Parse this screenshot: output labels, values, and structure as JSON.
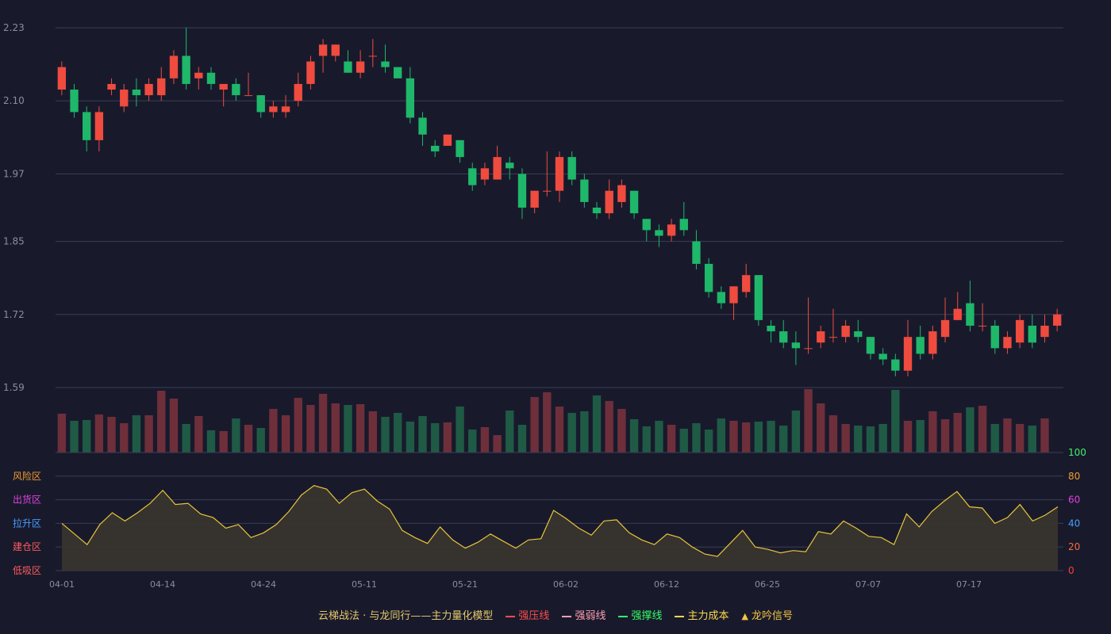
{
  "chart_data": {
    "type": "candlestick",
    "price_axis": {
      "ticks": [
        "2.23",
        "2.10",
        "1.97",
        "1.85",
        "1.72",
        "1.59"
      ],
      "ylim": [
        1.59,
        2.23
      ]
    },
    "x_ticks": [
      "04-01",
      "04-14",
      "04-24",
      "05-11",
      "05-21",
      "06-02",
      "06-12",
      "06-25",
      "07-07",
      "07-17"
    ],
    "candles": [
      [
        2.12,
        2.16,
        2.17,
        2.11
      ],
      [
        2.12,
        2.08,
        2.13,
        2.07
      ],
      [
        2.08,
        2.03,
        2.09,
        2.01
      ],
      [
        2.03,
        2.08,
        2.09,
        2.01
      ],
      [
        2.12,
        2.13,
        2.14,
        2.11
      ],
      [
        2.09,
        2.12,
        2.13,
        2.08
      ],
      [
        2.12,
        2.11,
        2.14,
        2.09
      ],
      [
        2.11,
        2.13,
        2.14,
        2.1
      ],
      [
        2.11,
        2.14,
        2.16,
        2.1
      ],
      [
        2.14,
        2.18,
        2.19,
        2.13
      ],
      [
        2.18,
        2.13,
        2.23,
        2.12
      ],
      [
        2.14,
        2.15,
        2.16,
        2.12
      ],
      [
        2.15,
        2.13,
        2.16,
        2.12
      ],
      [
        2.12,
        2.13,
        2.13,
        2.09
      ],
      [
        2.13,
        2.11,
        2.14,
        2.1
      ],
      [
        2.11,
        2.11,
        2.15,
        2.11
      ],
      [
        2.11,
        2.08,
        2.11,
        2.07
      ],
      [
        2.08,
        2.09,
        2.1,
        2.07
      ],
      [
        2.08,
        2.09,
        2.11,
        2.07
      ],
      [
        2.1,
        2.13,
        2.15,
        2.09
      ],
      [
        2.13,
        2.17,
        2.18,
        2.12
      ],
      [
        2.18,
        2.2,
        2.21,
        2.15
      ],
      [
        2.18,
        2.2,
        2.2,
        2.17
      ],
      [
        2.17,
        2.15,
        2.19,
        2.15
      ],
      [
        2.15,
        2.17,
        2.19,
        2.14
      ],
      [
        2.18,
        2.18,
        2.21,
        2.16
      ],
      [
        2.17,
        2.16,
        2.2,
        2.15
      ],
      [
        2.16,
        2.14,
        2.16,
        2.14
      ],
      [
        2.14,
        2.07,
        2.16,
        2.06
      ],
      [
        2.07,
        2.04,
        2.08,
        2.02
      ],
      [
        2.02,
        2.01,
        2.03,
        2.0
      ],
      [
        2.02,
        2.04,
        2.04,
        2.02
      ],
      [
        2.03,
        2.0,
        2.03,
        1.99
      ],
      [
        1.98,
        1.95,
        1.99,
        1.94
      ],
      [
        1.96,
        1.98,
        1.99,
        1.95
      ],
      [
        1.96,
        2.0,
        2.02,
        1.96
      ],
      [
        1.99,
        1.98,
        2.0,
        1.96
      ],
      [
        1.97,
        1.91,
        1.98,
        1.89
      ],
      [
        1.91,
        1.94,
        1.94,
        1.9
      ],
      [
        1.94,
        1.94,
        2.01,
        1.93
      ],
      [
        1.94,
        2.0,
        2.01,
        1.92
      ],
      [
        2.0,
        1.96,
        2.01,
        1.95
      ],
      [
        1.96,
        1.92,
        1.97,
        1.91
      ],
      [
        1.91,
        1.9,
        1.92,
        1.89
      ],
      [
        1.9,
        1.94,
        1.96,
        1.89
      ],
      [
        1.92,
        1.95,
        1.96,
        1.91
      ],
      [
        1.94,
        1.9,
        1.94,
        1.89
      ],
      [
        1.89,
        1.87,
        1.89,
        1.85
      ],
      [
        1.87,
        1.86,
        1.88,
        1.84
      ],
      [
        1.86,
        1.88,
        1.89,
        1.85
      ],
      [
        1.89,
        1.87,
        1.92,
        1.86
      ],
      [
        1.85,
        1.81,
        1.87,
        1.8
      ],
      [
        1.81,
        1.76,
        1.82,
        1.75
      ],
      [
        1.76,
        1.74,
        1.77,
        1.73
      ],
      [
        1.74,
        1.77,
        1.77,
        1.71
      ],
      [
        1.76,
        1.79,
        1.81,
        1.75
      ],
      [
        1.79,
        1.71,
        1.79,
        1.7
      ],
      [
        1.7,
        1.69,
        1.71,
        1.67
      ],
      [
        1.69,
        1.67,
        1.71,
        1.66
      ],
      [
        1.67,
        1.66,
        1.69,
        1.63
      ],
      [
        1.66,
        1.66,
        1.75,
        1.65
      ],
      [
        1.67,
        1.69,
        1.7,
        1.66
      ],
      [
        1.68,
        1.68,
        1.73,
        1.67
      ],
      [
        1.68,
        1.7,
        1.71,
        1.67
      ],
      [
        1.69,
        1.68,
        1.71,
        1.67
      ],
      [
        1.68,
        1.65,
        1.68,
        1.64
      ],
      [
        1.65,
        1.64,
        1.66,
        1.63
      ],
      [
        1.64,
        1.62,
        1.65,
        1.61
      ],
      [
        1.62,
        1.68,
        1.71,
        1.61
      ],
      [
        1.68,
        1.65,
        1.7,
        1.64
      ],
      [
        1.65,
        1.69,
        1.7,
        1.64
      ],
      [
        1.68,
        1.71,
        1.75,
        1.67
      ],
      [
        1.71,
        1.73,
        1.76,
        1.71
      ],
      [
        1.74,
        1.7,
        1.78,
        1.69
      ],
      [
        1.7,
        1.7,
        1.74,
        1.69
      ],
      [
        1.7,
        1.66,
        1.71,
        1.65
      ],
      [
        1.66,
        1.68,
        1.69,
        1.65
      ],
      [
        1.67,
        1.71,
        1.72,
        1.66
      ],
      [
        1.7,
        1.67,
        1.72,
        1.66
      ],
      [
        1.68,
        1.7,
        1.72,
        1.67
      ],
      [
        1.7,
        1.72,
        1.73,
        1.69
      ]
    ],
    "volume": [
      49,
      40,
      41,
      48,
      45,
      37,
      47,
      47,
      78,
      68,
      36,
      46,
      28,
      27,
      43,
      35,
      31,
      55,
      47,
      69,
      60,
      74,
      62,
      60,
      61,
      52,
      45,
      50,
      39,
      46,
      37,
      38,
      58,
      29,
      32,
      22,
      53,
      35,
      70,
      76,
      58,
      50,
      52,
      72,
      65,
      55,
      42,
      33,
      40,
      35,
      30,
      37,
      29,
      43,
      40,
      38,
      39,
      40,
      34,
      53,
      80,
      62,
      47,
      36,
      34,
      33,
      36,
      79,
      40,
      41,
      52,
      42,
      50,
      57,
      59,
      36,
      43,
      36,
      34,
      43
    ],
    "indicator": {
      "y_ticks": [
        "100",
        "80",
        "60",
        "40",
        "20",
        "0"
      ],
      "ylim": [
        0,
        100
      ],
      "zones": [
        "风险区",
        "出货区",
        "拉升区",
        "建仓区",
        "低吸区"
      ],
      "values": [
        40,
        31,
        22,
        39,
        49,
        42,
        49,
        57,
        68,
        56,
        57,
        48,
        45,
        36,
        39,
        28,
        32,
        39,
        50,
        64,
        72,
        69,
        57,
        66,
        69,
        59,
        52,
        34,
        28,
        23,
        37,
        26,
        19,
        24,
        31,
        25,
        19,
        26,
        27,
        51,
        44,
        36,
        30,
        42,
        43,
        32,
        26,
        22,
        31,
        28,
        20,
        14,
        12,
        23,
        34,
        20,
        18,
        15,
        17,
        16,
        33,
        31,
        42,
        36,
        29,
        28,
        22,
        48,
        37,
        50,
        59,
        67,
        54,
        53,
        40,
        45,
        56,
        42,
        47,
        54
      ]
    },
    "legend": [
      {
        "label": "云梯战法 · 与龙同行——主力量化模型",
        "marker": "none"
      },
      {
        "label": "强压线",
        "marker": "solid",
        "color": "#ff4d4d"
      },
      {
        "label": "强弱线",
        "marker": "dashed",
        "color": "#ff9fb0"
      },
      {
        "label": "强撑线",
        "marker": "solid",
        "color": "#33ff66"
      },
      {
        "label": "主力成本",
        "marker": "dashed",
        "color": "#ffd94d"
      },
      {
        "label": "龙吟信号",
        "marker": "triangle",
        "color": "#f5c542"
      }
    ],
    "colors": {
      "up": "#ef4b3f",
      "down": "#1fb76a",
      "volume_up": "#6e2f3a",
      "volume_down": "#1f5a45",
      "indicator_line": "#e8c53a",
      "indicator_fill": "#3a352e",
      "grid": "#3a3d52",
      "axis_text": "#8a8d9a",
      "zone_risk": "#f29a2e",
      "zone_distribute": "#e040e0",
      "zone_pull": "#4a9cff",
      "zone_build": "#ff5a5a",
      "zone_low": "#ff5a5a",
      "tick_100": "#44ee66",
      "tick_80": "#f29a2e",
      "tick_60": "#e040e0",
      "tick_40": "#4a9cff",
      "tick_20": "#ff6a3a",
      "tick_0": "#ff3b3b"
    }
  }
}
